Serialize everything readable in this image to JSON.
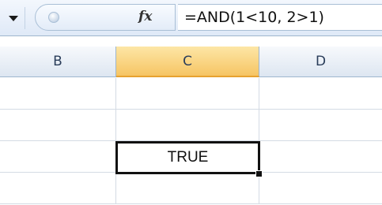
{
  "formula_bar": {
    "name_box_dropdown_icon": "chevron-down-icon",
    "fx_label": "fx",
    "formula": "=AND(1<10, 2>1)"
  },
  "columns": [
    {
      "label": "B",
      "selected": false
    },
    {
      "label": "C",
      "selected": true
    },
    {
      "label": "D",
      "selected": false
    }
  ],
  "rows": [
    {
      "B": "",
      "C": "",
      "D": ""
    },
    {
      "B": "",
      "C": "",
      "D": ""
    },
    {
      "B": "",
      "C": "TRUE",
      "D": ""
    },
    {
      "B": "",
      "C": "",
      "D": ""
    }
  ],
  "active_cell": {
    "column": "C",
    "row_index": 2,
    "value": "TRUE"
  },
  "colors": {
    "selected_header": "#f6c564",
    "header": "#dde6f1",
    "gridline": "#d4dbe4",
    "selection_border": "#111111"
  }
}
